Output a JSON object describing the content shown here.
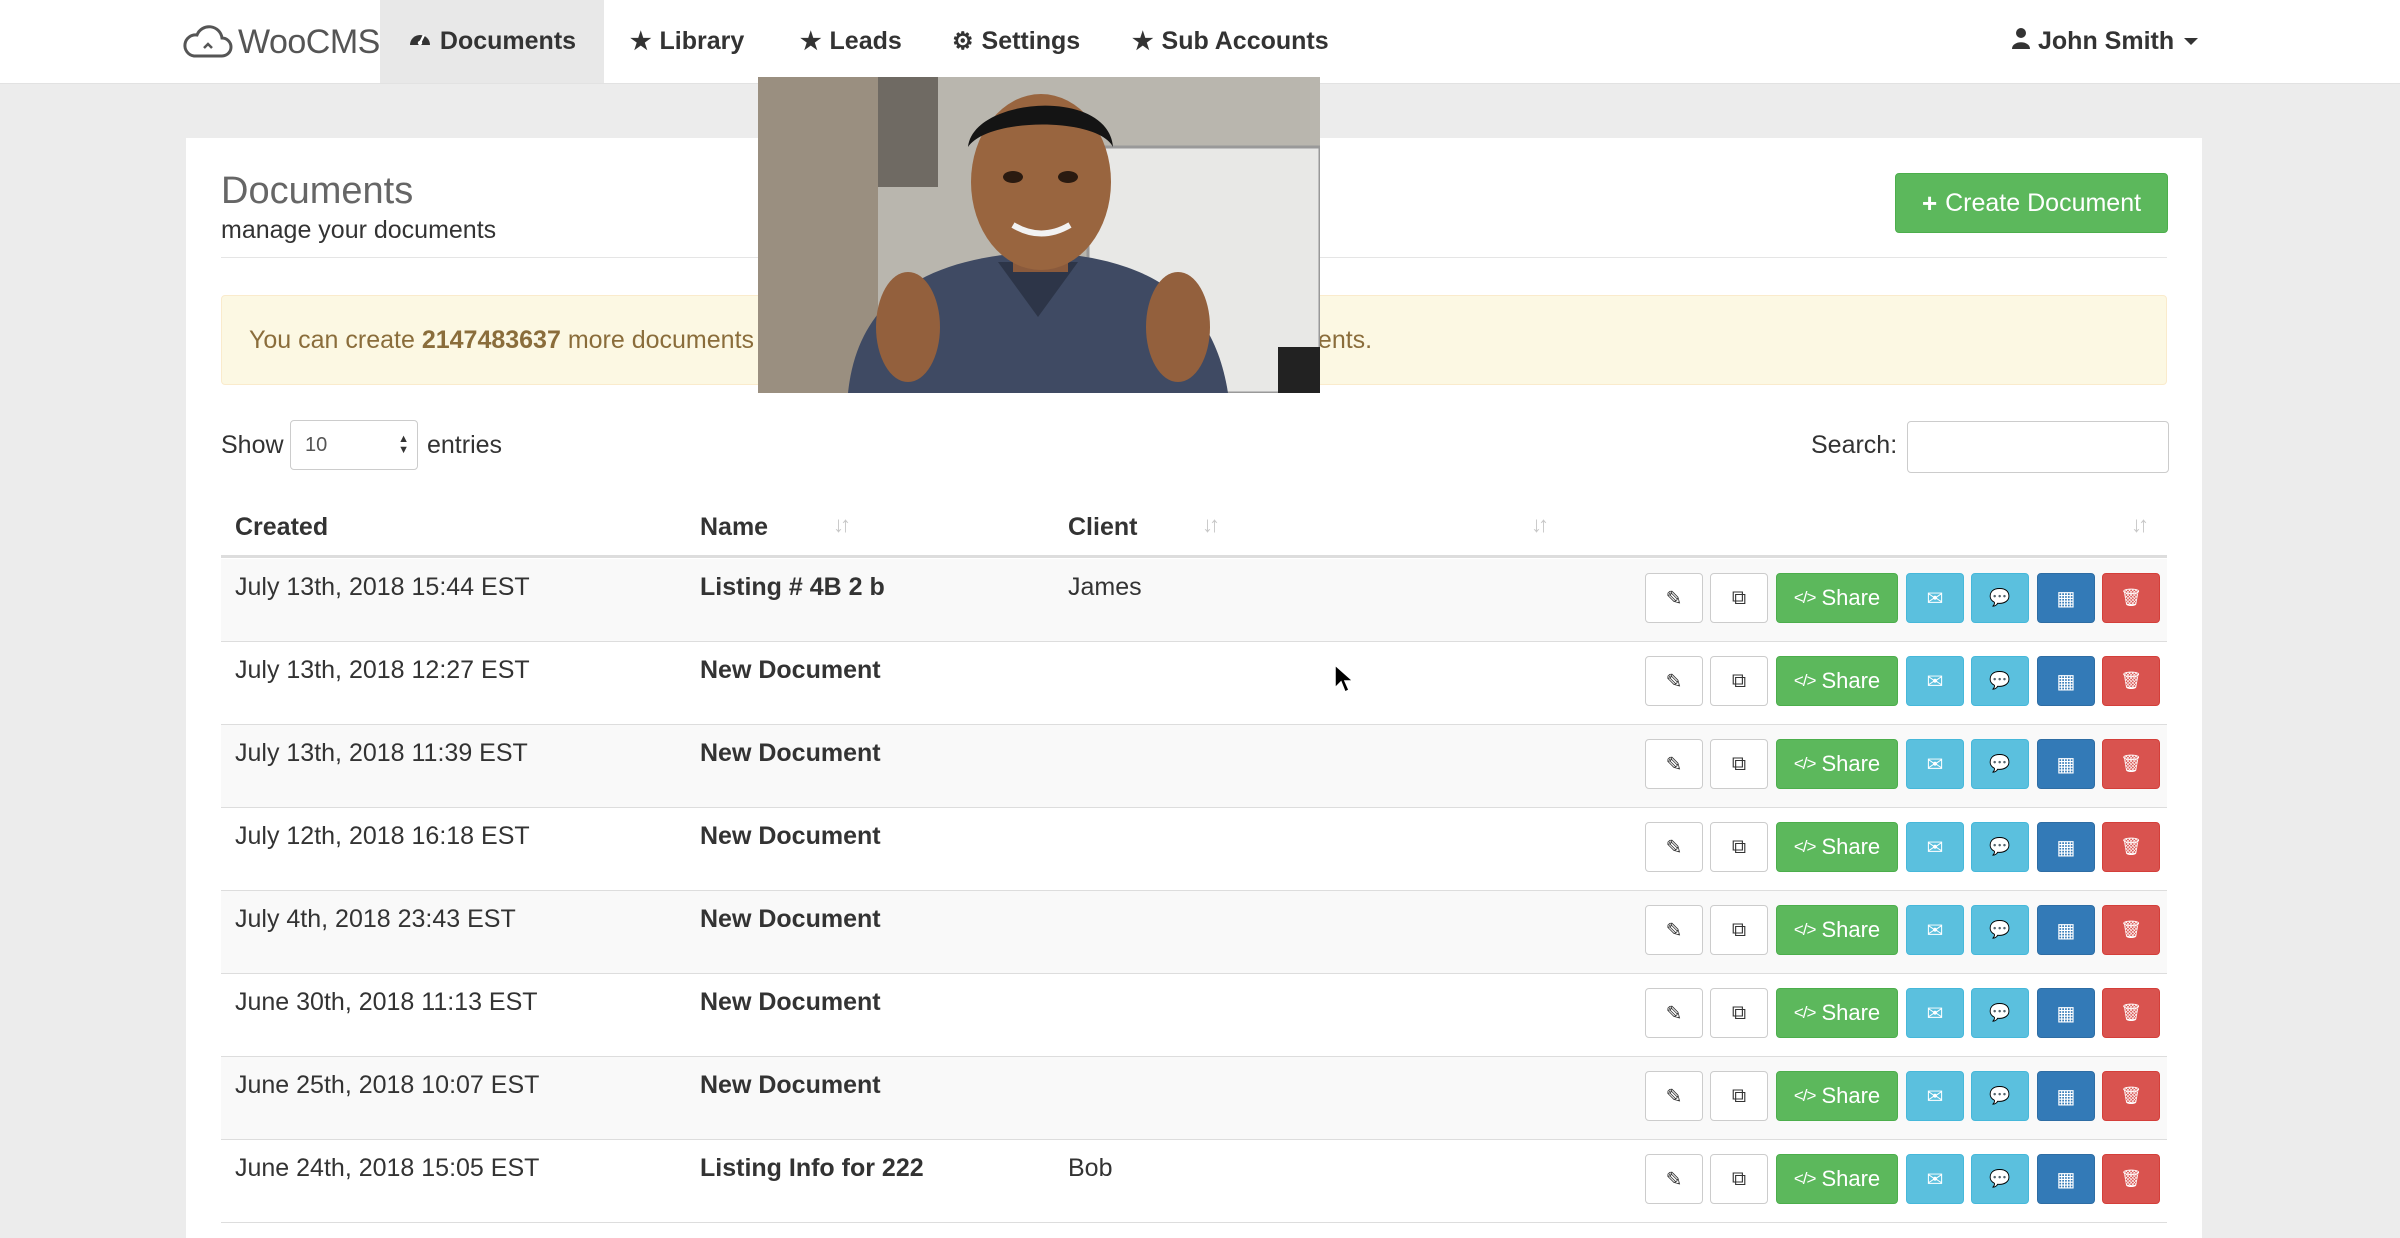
{
  "nav": {
    "brand": "WooCMS",
    "items": [
      {
        "label": "Documents",
        "icon": "dashboard-icon",
        "active": true
      },
      {
        "label": "Library",
        "icon": "star-icon"
      },
      {
        "label": "Leads",
        "icon": "star-icon"
      },
      {
        "label": "Settings",
        "icon": "gear-icon"
      },
      {
        "label": "Sub Accounts",
        "icon": "star-icon"
      }
    ],
    "user": "John Smith"
  },
  "page": {
    "title": "Documents",
    "subtitle": "manage your documents",
    "create_button": "Create Document"
  },
  "alert": {
    "prefix": "You can create ",
    "count": "2147483637",
    "visible_middle": " more documents",
    "visible_end": "nents."
  },
  "table_controls": {
    "show_label": "Show",
    "page_size": "10",
    "entries_label": "entries",
    "search_label": "Search:",
    "search_value": ""
  },
  "table": {
    "columns": [
      "Created",
      "Name",
      "Client"
    ],
    "share_label": "Share",
    "rows": [
      {
        "created": "July 13th, 2018 15:44 EST",
        "name": "Listing # 4B 2 b",
        "client": "James"
      },
      {
        "created": "July 13th, 2018 12:27 EST",
        "name": "New Document",
        "client": ""
      },
      {
        "created": "July 13th, 2018 11:39 EST",
        "name": "New Document",
        "client": ""
      },
      {
        "created": "July 12th, 2018 16:18 EST",
        "name": "New Document",
        "client": ""
      },
      {
        "created": "July 4th, 2018 23:43 EST",
        "name": "New Document",
        "client": ""
      },
      {
        "created": "June 30th, 2018 11:13 EST",
        "name": "New Document",
        "client": ""
      },
      {
        "created": "June 25th, 2018 10:07 EST",
        "name": "New Document",
        "client": ""
      },
      {
        "created": "June 24th, 2018 15:05 EST",
        "name": "Listing Info for 222",
        "client": "Bob"
      }
    ]
  },
  "colors": {
    "success": "#5cb85c",
    "info": "#5bc0de",
    "primary": "#337ab7",
    "danger": "#d9534f",
    "warning_bg": "#fcf8e3",
    "warning_text": "#8a6d3b"
  }
}
